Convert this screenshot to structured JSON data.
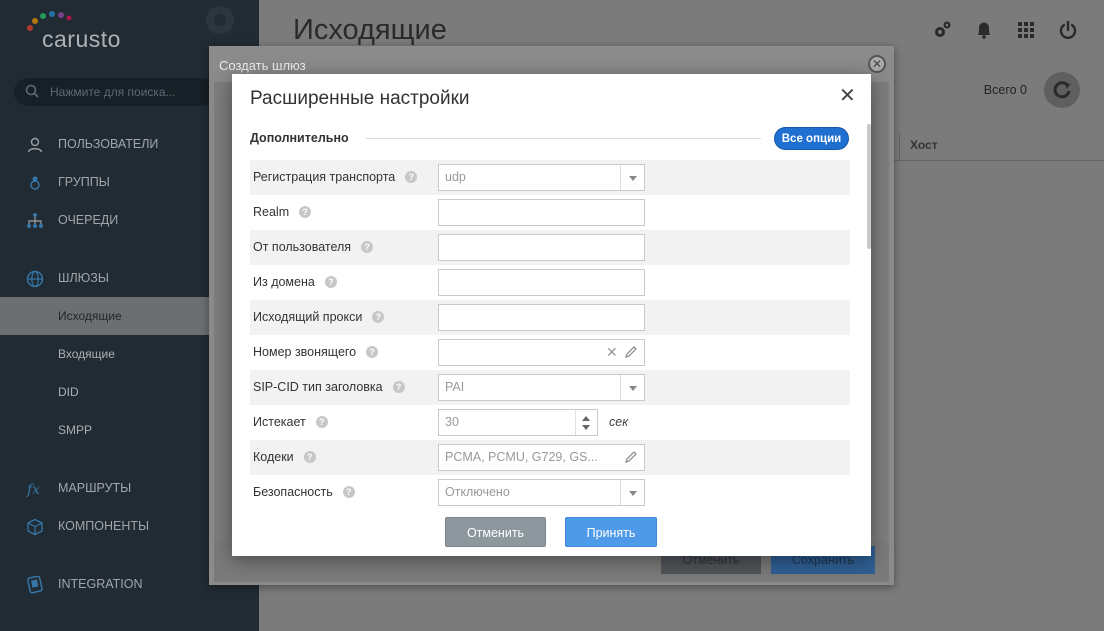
{
  "app": {
    "logo_text": "carusto"
  },
  "search": {
    "placeholder": "Нажмите для поиска..."
  },
  "sidebar": {
    "items": [
      {
        "label": "ПОЛЬЗОВАТЕЛИ",
        "icon": "user-icon"
      },
      {
        "label": "ГРУППЫ",
        "icon": "groups-icon"
      },
      {
        "label": "ОЧЕРЕДИ",
        "icon": "queues-icon"
      },
      {
        "label": "ШЛЮЗЫ",
        "icon": "globe-icon"
      },
      {
        "label": "МАРШРУТЫ",
        "icon": "fx-icon"
      },
      {
        "label": "КОМПОНЕНТЫ",
        "icon": "cube-icon"
      },
      {
        "label": "INTEGRATION",
        "icon": "integration-icon"
      }
    ],
    "gateway_subitems": [
      {
        "label": "Исходящие",
        "active": true
      },
      {
        "label": "Входящие",
        "active": false
      },
      {
        "label": "DID",
        "active": false
      },
      {
        "label": "SMPP",
        "active": false
      }
    ]
  },
  "header": {
    "title": "Исходящие",
    "total_label": "Всего 0",
    "icons": [
      "gears-icon",
      "bell-icon",
      "apps-grid-icon",
      "power-icon"
    ]
  },
  "table": {
    "columns": [
      "Хост"
    ]
  },
  "outer_modal": {
    "title": "Создать шлюз",
    "cancel_label": "Отменить",
    "save_label": "Сохранить"
  },
  "dialog": {
    "title": "Расширенные настройки",
    "section_title": "Дополнительно",
    "all_options_label": "Все опции",
    "fields": [
      {
        "label": "Регистрация транспорта",
        "type": "select",
        "value": "udp"
      },
      {
        "label": "Realm",
        "type": "text",
        "value": ""
      },
      {
        "label": "От пользователя",
        "type": "text",
        "value": ""
      },
      {
        "label": "Из домена",
        "type": "text",
        "value": ""
      },
      {
        "label": "Исходящий прокси",
        "type": "text",
        "value": ""
      },
      {
        "label": "Номер звонящего",
        "type": "text-edit",
        "value": ""
      },
      {
        "label": "SIP-CID тип заголовка",
        "type": "select",
        "value": "PAI"
      },
      {
        "label": "Истекает",
        "type": "number",
        "value": "30",
        "unit": "сек"
      },
      {
        "label": "Кодеки",
        "type": "edit",
        "value": "PCMA, PCMU, G729, GS..."
      },
      {
        "label": "Безопасность",
        "type": "select",
        "value": "Отключено"
      }
    ],
    "cancel_label": "Отменить",
    "accept_label": "Принять"
  },
  "colors": {
    "accent": "#1f6fd0",
    "accept_button": "#4f9ae8",
    "sidebar_bg": "#2c3a44"
  }
}
